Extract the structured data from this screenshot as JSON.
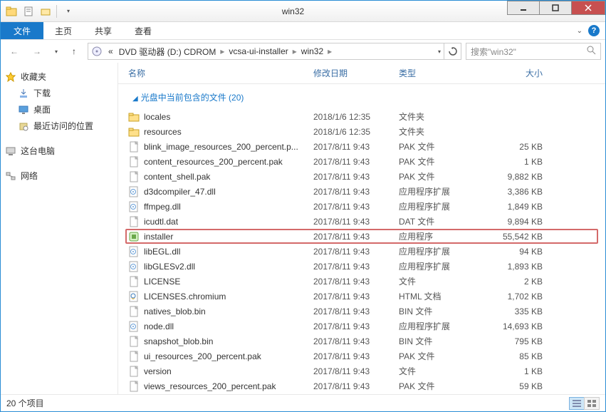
{
  "window": {
    "title": "win32"
  },
  "ribbon": {
    "file": "文件",
    "tabs": [
      "主页",
      "共享",
      "查看"
    ]
  },
  "breadcrumb": {
    "prefix": "«",
    "segments": [
      "DVD 驱动器 (D:) CDROM",
      "vcsa-ui-installer",
      "win32"
    ]
  },
  "search": {
    "placeholder": "搜索\"win32\""
  },
  "sidebar": {
    "favorites": {
      "label": "收藏夹",
      "items": [
        "下载",
        "桌面",
        "最近访问的位置"
      ]
    },
    "thispc": {
      "label": "这台电脑"
    },
    "network": {
      "label": "网络"
    }
  },
  "columns": {
    "name": "名称",
    "date": "修改日期",
    "type": "类型",
    "size": "大小"
  },
  "group_title": "光盘中当前包含的文件 (20)",
  "files": [
    {
      "icon": "folder",
      "name": "locales",
      "date": "2018/1/6 12:35",
      "type": "文件夹",
      "size": ""
    },
    {
      "icon": "folder",
      "name": "resources",
      "date": "2018/1/6 12:35",
      "type": "文件夹",
      "size": ""
    },
    {
      "icon": "file",
      "name": "blink_image_resources_200_percent.p...",
      "date": "2017/8/11 9:43",
      "type": "PAK 文件",
      "size": "25 KB"
    },
    {
      "icon": "file",
      "name": "content_resources_200_percent.pak",
      "date": "2017/8/11 9:43",
      "type": "PAK 文件",
      "size": "1 KB"
    },
    {
      "icon": "file",
      "name": "content_shell.pak",
      "date": "2017/8/11 9:43",
      "type": "PAK 文件",
      "size": "9,882 KB"
    },
    {
      "icon": "dll",
      "name": "d3dcompiler_47.dll",
      "date": "2017/8/11 9:43",
      "type": "应用程序扩展",
      "size": "3,386 KB"
    },
    {
      "icon": "dll",
      "name": "ffmpeg.dll",
      "date": "2017/8/11 9:43",
      "type": "应用程序扩展",
      "size": "1,849 KB"
    },
    {
      "icon": "file",
      "name": "icudtl.dat",
      "date": "2017/8/11 9:43",
      "type": "DAT 文件",
      "size": "9,894 KB"
    },
    {
      "icon": "exe",
      "name": "installer",
      "date": "2017/8/11 9:43",
      "type": "应用程序",
      "size": "55,542 KB",
      "highlight": true
    },
    {
      "icon": "dll",
      "name": "libEGL.dll",
      "date": "2017/8/11 9:43",
      "type": "应用程序扩展",
      "size": "94 KB"
    },
    {
      "icon": "dll",
      "name": "libGLESv2.dll",
      "date": "2017/8/11 9:43",
      "type": "应用程序扩展",
      "size": "1,893 KB"
    },
    {
      "icon": "file",
      "name": "LICENSE",
      "date": "2017/8/11 9:43",
      "type": "文件",
      "size": "2 KB"
    },
    {
      "icon": "html",
      "name": "LICENSES.chromium",
      "date": "2017/8/11 9:43",
      "type": "HTML 文档",
      "size": "1,702 KB"
    },
    {
      "icon": "file",
      "name": "natives_blob.bin",
      "date": "2017/8/11 9:43",
      "type": "BIN 文件",
      "size": "335 KB"
    },
    {
      "icon": "dll",
      "name": "node.dll",
      "date": "2017/8/11 9:43",
      "type": "应用程序扩展",
      "size": "14,693 KB"
    },
    {
      "icon": "file",
      "name": "snapshot_blob.bin",
      "date": "2017/8/11 9:43",
      "type": "BIN 文件",
      "size": "795 KB"
    },
    {
      "icon": "file",
      "name": "ui_resources_200_percent.pak",
      "date": "2017/8/11 9:43",
      "type": "PAK 文件",
      "size": "85 KB"
    },
    {
      "icon": "file",
      "name": "version",
      "date": "2017/8/11 9:43",
      "type": "文件",
      "size": "1 KB"
    },
    {
      "icon": "file",
      "name": "views_resources_200_percent.pak",
      "date": "2017/8/11 9:43",
      "type": "PAK 文件",
      "size": "59 KB"
    }
  ],
  "status": {
    "text": "20 个项目"
  }
}
